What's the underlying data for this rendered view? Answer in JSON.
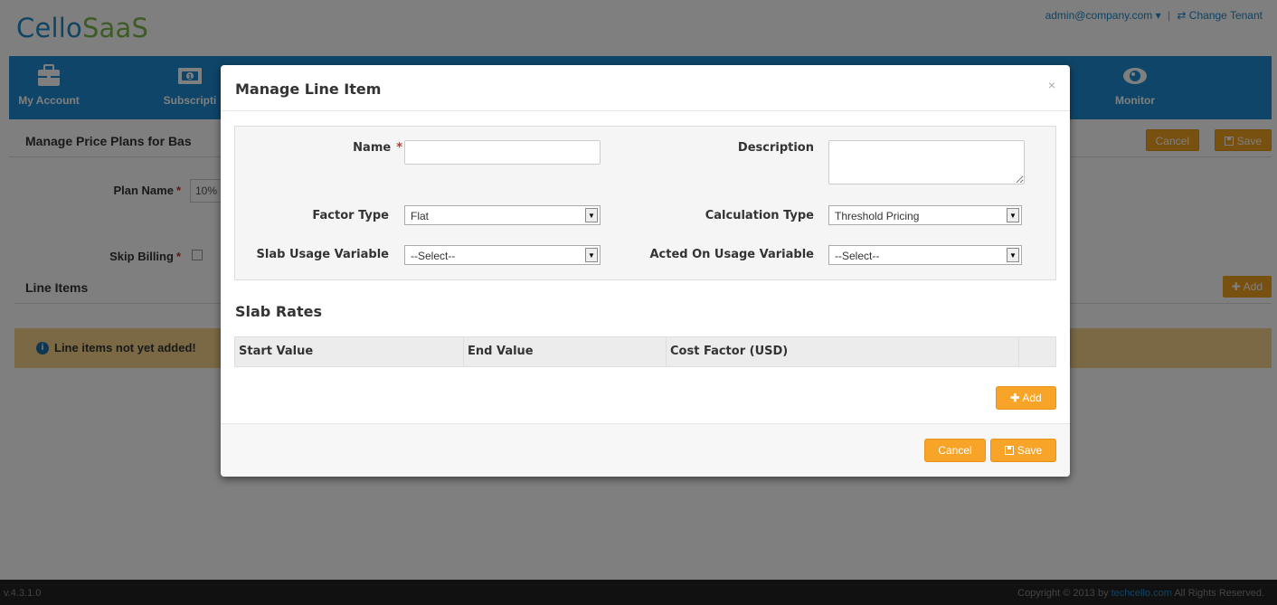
{
  "app": {
    "logo_part1": "Cello",
    "logo_part2": "SaaS"
  },
  "top_links": {
    "user": "admin@company.com ▾",
    "separator": "|",
    "change_tenant": "⇄ Change Tenant"
  },
  "nav": {
    "my_account": "My Account",
    "subscription": "Subscripti",
    "monitor": "Monitor"
  },
  "page": {
    "title": "Manage Price Plans for Bas",
    "cancel_label": "Cancel",
    "save_label": "Save",
    "plan_name_label": "Plan Name",
    "plan_name_value": "10%",
    "skip_billing_label": "Skip Billing",
    "required_mark": "*",
    "line_items_title": "Line Items",
    "add_label": "Add",
    "notice_text": "Line items not yet added!"
  },
  "footer": {
    "version": "v.4.3.1.0",
    "copy_prefix": "Copyright © 2013 by ",
    "brand": "techcello.com",
    "copy_suffix": " All Rights Reserved."
  },
  "modal": {
    "title": "Manage Line Item",
    "close": "×",
    "form": {
      "name_label": "Name",
      "required_mark": "*",
      "name_value": "",
      "description_label": "Description",
      "description_value": "",
      "factor_type_label": "Factor Type",
      "factor_type_value": "Flat",
      "calculation_type_label": "Calculation Type",
      "calculation_type_value": "Threshold Pricing",
      "slab_usage_label": "Slab Usage Variable",
      "slab_usage_value": "--Select--",
      "acted_on_label": "Acted On Usage Variable",
      "acted_on_value": "--Select--"
    },
    "slab_rates": {
      "title": "Slab Rates",
      "columns": [
        "Start Value",
        "End Value",
        "Cost Factor (USD)",
        ""
      ],
      "add_label": "Add"
    },
    "footer": {
      "cancel_label": "Cancel",
      "save_label": "Save"
    }
  },
  "colors": {
    "brand_blue": "#1d8ad0",
    "accent_orange": "#f7a428",
    "logo_green": "#7ab648"
  }
}
